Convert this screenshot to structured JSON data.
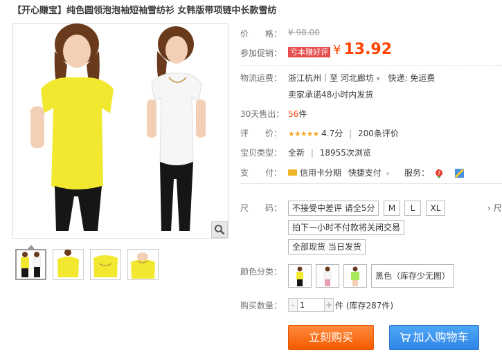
{
  "title": "【开心赚宝】纯色圆领泡泡袖短袖雪纺衫 女韩版带项链中长款雪纺",
  "price": {
    "label": "价　　格：",
    "original": "¥ 98.00"
  },
  "promo": {
    "label": "参加促销：",
    "tag": "亏本赚好评",
    "yen": "¥",
    "price": "13.92"
  },
  "shipping": {
    "label": "物流运费：",
    "route": "浙江杭州｜至  河北廊坊",
    "arrow": "▾",
    "fee": "快递: 免运费",
    "promise": "卖家承诺48小时内发货"
  },
  "sales": {
    "label": "30天售出：",
    "count": "56",
    "unit": "件"
  },
  "rating": {
    "label": "评　　价：",
    "stars": "★★★★★",
    "score": "4.7分",
    "divider": "|",
    "reviews": "200条评价"
  },
  "product_type": {
    "label": "宝贝类型：",
    "type": "全新",
    "divider": "|",
    "views": "18955次浏览"
  },
  "payment": {
    "label": "支　　付：",
    "credit": "信用卡分期",
    "quick": "快捷支付",
    "service_label": "服务："
  },
  "size": {
    "label": "尺　　码：",
    "options": [
      "不接受中差评 请全5分",
      "M",
      "L",
      "XL"
    ],
    "notes": [
      "拍下一小时不付款将关闭交易",
      "全部现货 当日发货"
    ],
    "side_link": "› 尺"
  },
  "color": {
    "label": "颜色分类：",
    "text_option": "黑色（库存少无图）"
  },
  "quantity": {
    "label": "购买数量：",
    "value": "1",
    "minus": "-",
    "plus": "+",
    "stock": "件 (库存287件)"
  },
  "buttons": {
    "buy_now": "立刻购买",
    "add_cart": "加入购物车"
  },
  "colors": {
    "price_orange": "#ff4400",
    "promo_red": "#e54e4e",
    "buy_orange": "#f45c00",
    "cart_blue": "#2f86e6"
  }
}
